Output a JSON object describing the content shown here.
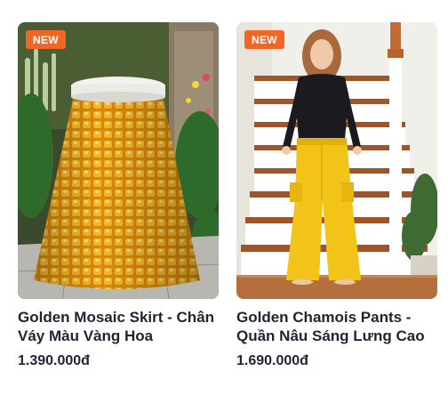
{
  "products": [
    {
      "badge": "NEW",
      "name": "Golden Mosaic Skirt - Chân Váy Màu Vàng Hoa",
      "price": "1.390.000đ",
      "image": "golden-sequin-skirt-photo"
    },
    {
      "badge": "NEW",
      "name": "Golden Chamois Pants - Quần Nâu Sáng Lưng Cao",
      "price": "1.690.000đ",
      "image": "model-yellow-cargo-pants-photo"
    }
  ],
  "colors": {
    "badge": "#f26522",
    "text": "#1f2433"
  }
}
